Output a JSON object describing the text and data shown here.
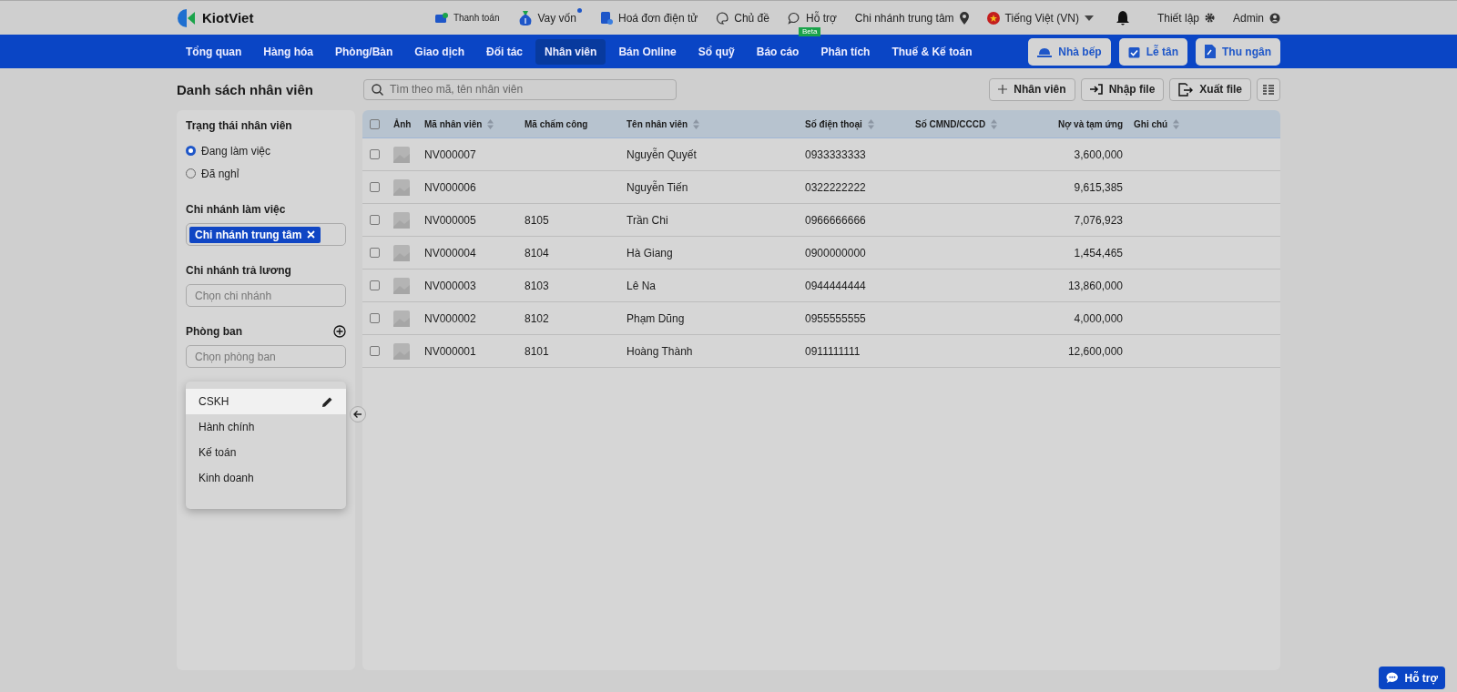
{
  "logo": {
    "name": "KiotViet"
  },
  "top_links": [
    {
      "kind": "payment",
      "label": "Thanh toán",
      "dot": false
    },
    {
      "kind": "loan",
      "label": "Vay vốn",
      "dot": true
    },
    {
      "kind": "invoice",
      "label": "Hoá đơn điện tử",
      "dot": false
    },
    {
      "kind": "theme",
      "label": "Chủ đề",
      "dot": false
    },
    {
      "kind": "support",
      "label": "Hỗ trợ",
      "dot": false,
      "badge": "Beta"
    }
  ],
  "branch": "Chi nhánh trung tâm",
  "language": "Tiếng Việt (VN)",
  "settings": "Thiết lập",
  "user": "Admin",
  "nav": [
    {
      "label": "Tổng quan",
      "selected": false
    },
    {
      "label": "Hàng hóa",
      "selected": false
    },
    {
      "label": "Phòng/Bàn",
      "selected": false
    },
    {
      "label": "Giao dịch",
      "selected": false
    },
    {
      "label": "Đối tác",
      "selected": false
    },
    {
      "label": "Nhân viên",
      "selected": true
    },
    {
      "label": "Bán Online",
      "selected": false
    },
    {
      "label": "Sổ quỹ",
      "selected": false
    },
    {
      "label": "Báo cáo",
      "selected": false
    },
    {
      "label": "Phân tích",
      "selected": false
    },
    {
      "label": "Thuế & Kế toán",
      "selected": false
    }
  ],
  "nav_buttons": [
    {
      "kind": "kitchen",
      "label": "Nhà bếp"
    },
    {
      "kind": "reception",
      "label": "Lễ tân"
    },
    {
      "kind": "cashier",
      "label": "Thu ngân"
    }
  ],
  "page_title": "Danh sách nhân viên",
  "search": {
    "placeholder": "Tìm theo mã, tên nhân viên"
  },
  "actions": [
    {
      "kind": "add",
      "label": "Nhân viên"
    },
    {
      "kind": "import",
      "label": "Nhập file"
    },
    {
      "kind": "export",
      "label": "Xuất file"
    }
  ],
  "filters": {
    "status": {
      "title": "Trạng thái nhân viên",
      "options": [
        {
          "label": "Đang làm việc",
          "selected": true
        },
        {
          "label": "Đã nghỉ",
          "selected": false
        }
      ]
    },
    "work_branch": {
      "title": "Chi nhánh làm việc",
      "tags": [
        "Chi nhánh trung tâm"
      ]
    },
    "pay_branch": {
      "title": "Chi nhánh trả lương",
      "placeholder": "Chọn chi nhánh"
    },
    "department": {
      "title": "Phòng ban",
      "placeholder": "Chọn phòng ban",
      "options": [
        {
          "label": "CSKH",
          "selected": true
        },
        {
          "label": "Hành chính",
          "selected": false
        },
        {
          "label": "Kế toán",
          "selected": false
        },
        {
          "label": "Kinh doanh",
          "selected": false
        }
      ]
    }
  },
  "table": {
    "all_checked": false,
    "columns": [
      {
        "label": "Ảnh",
        "sortable": false
      },
      {
        "label": "Mã nhân viên",
        "sortable": true
      },
      {
        "label": "Mã chấm công",
        "sortable": false
      },
      {
        "label": "Tên nhân viên",
        "sortable": true
      },
      {
        "label": "Số điện thoại",
        "sortable": true
      },
      {
        "label": "Số CMND/CCCD",
        "sortable": true
      },
      {
        "label": "Nợ và tạm ứng",
        "sortable": false
      },
      {
        "label": "Ghi chú",
        "sortable": true
      }
    ],
    "rows": [
      {
        "checked": false,
        "code": "NV000007",
        "timecode": "",
        "name": "Nguyễn Quyết",
        "phone": "0933333333",
        "id_number": "",
        "debt": "3,600,000",
        "note": ""
      },
      {
        "checked": false,
        "code": "NV000006",
        "timecode": "",
        "name": "Nguyễn Tiến",
        "phone": "0322222222",
        "id_number": "",
        "debt": "9,615,385",
        "note": ""
      },
      {
        "checked": false,
        "code": "NV000005",
        "timecode": "8105",
        "name": "Trần Chi",
        "phone": "0966666666",
        "id_number": "",
        "debt": "7,076,923",
        "note": ""
      },
      {
        "checked": false,
        "code": "NV000004",
        "timecode": "8104",
        "name": "Hà Giang",
        "phone": "0900000000",
        "id_number": "",
        "debt": "1,454,465",
        "note": ""
      },
      {
        "checked": false,
        "code": "NV000003",
        "timecode": "8103",
        "name": "Lê Na",
        "phone": "0944444444",
        "id_number": "",
        "debt": "13,860,000",
        "note": ""
      },
      {
        "checked": false,
        "code": "NV000002",
        "timecode": "8102",
        "name": "Phạm Dũng",
        "phone": "0955555555",
        "id_number": "",
        "debt": "4,000,000",
        "note": ""
      },
      {
        "checked": false,
        "code": "NV000001",
        "timecode": "8101",
        "name": "Hoàng Thành",
        "phone": "0911111111",
        "id_number": "",
        "debt": "12,600,000",
        "note": ""
      }
    ]
  },
  "help_button": "Hỗ trợ"
}
